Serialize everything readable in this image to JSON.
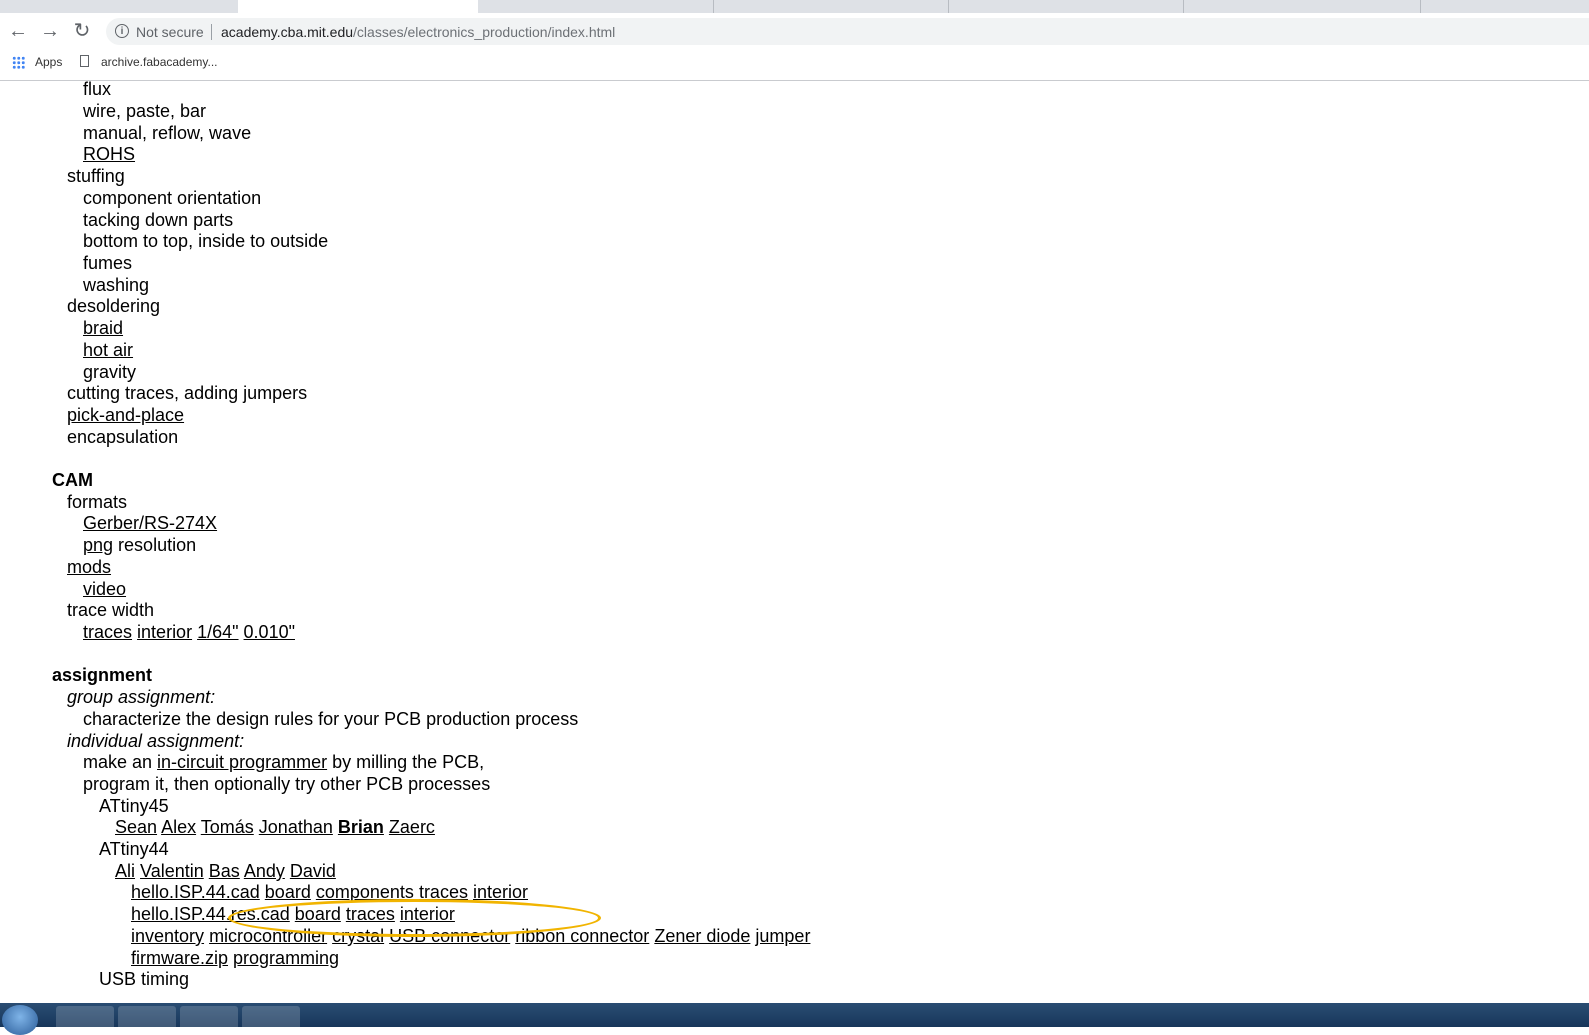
{
  "browser": {
    "security_label": "Not secure",
    "url_host": "academy.cba.mit.edu",
    "url_path": "/classes/electronics_production/index.html",
    "bookmarks": [
      {
        "label": "Apps",
        "icon": "apps-grid-icon"
      },
      {
        "label": "archive.fabacademy...",
        "icon": "document-icon"
      }
    ]
  },
  "page": {
    "soldering": {
      "flux": "flux",
      "wire_paste_bar": "wire, paste, bar",
      "manual_reflow_wave": "manual, reflow, wave",
      "rohs": "ROHS"
    },
    "stuffing": {
      "title": "stuffing",
      "items": [
        "component orientation",
        "tacking down parts",
        "bottom to top, inside to outside",
        "fumes",
        "washing"
      ]
    },
    "desoldering": {
      "title": "desoldering",
      "braid": "braid",
      "hot_air": "hot air",
      "gravity": "gravity"
    },
    "misc": {
      "cutting": "cutting traces, adding jumpers",
      "pick_and_place": "pick-and-place",
      "encapsulation": "encapsulation"
    },
    "cam": {
      "heading": "CAM",
      "formats": "formats",
      "gerber": "Gerber/RS-274X",
      "png": "png",
      "resolution": " resolution",
      "mods": "mods",
      "video": "video",
      "trace_width": "trace width",
      "traces": "traces",
      "interior": "interior",
      "w164": "1/64\"",
      "w010": "0.010\""
    },
    "assignment": {
      "heading": "assignment",
      "group_label": "group assignment:",
      "group_text": "characterize the design rules for your PCB production process",
      "individual_label": "individual assignment:",
      "make_an": "make an ",
      "programmer_link": "in-circuit programmer",
      "by_milling": " by milling the PCB,",
      "program_it": "program it, then optionally try other PCB processes",
      "attiny45": "ATtiny45",
      "attiny45_people": [
        "Sean",
        "Alex",
        "Tomás",
        "Jonathan",
        "Brian",
        "Zaerc"
      ],
      "attiny44": "ATtiny44",
      "attiny44_people": [
        "Ali",
        "Valentin",
        "Bas",
        "Andy",
        "David"
      ],
      "row1": [
        "hello.ISP.44.cad",
        "board",
        "components",
        "traces",
        "interior"
      ],
      "row2": [
        "hello.ISP.44.res.cad",
        "board",
        "traces",
        "interior"
      ],
      "row3": [
        "inventory",
        "microcontroller",
        "crystal",
        "USB connector",
        "ribbon connector",
        "Zener diode",
        "jumper"
      ],
      "row4": [
        "firmware.zip",
        "programming"
      ],
      "usb_timing": "USB timing"
    }
  },
  "annotation_color": "#f1b400"
}
